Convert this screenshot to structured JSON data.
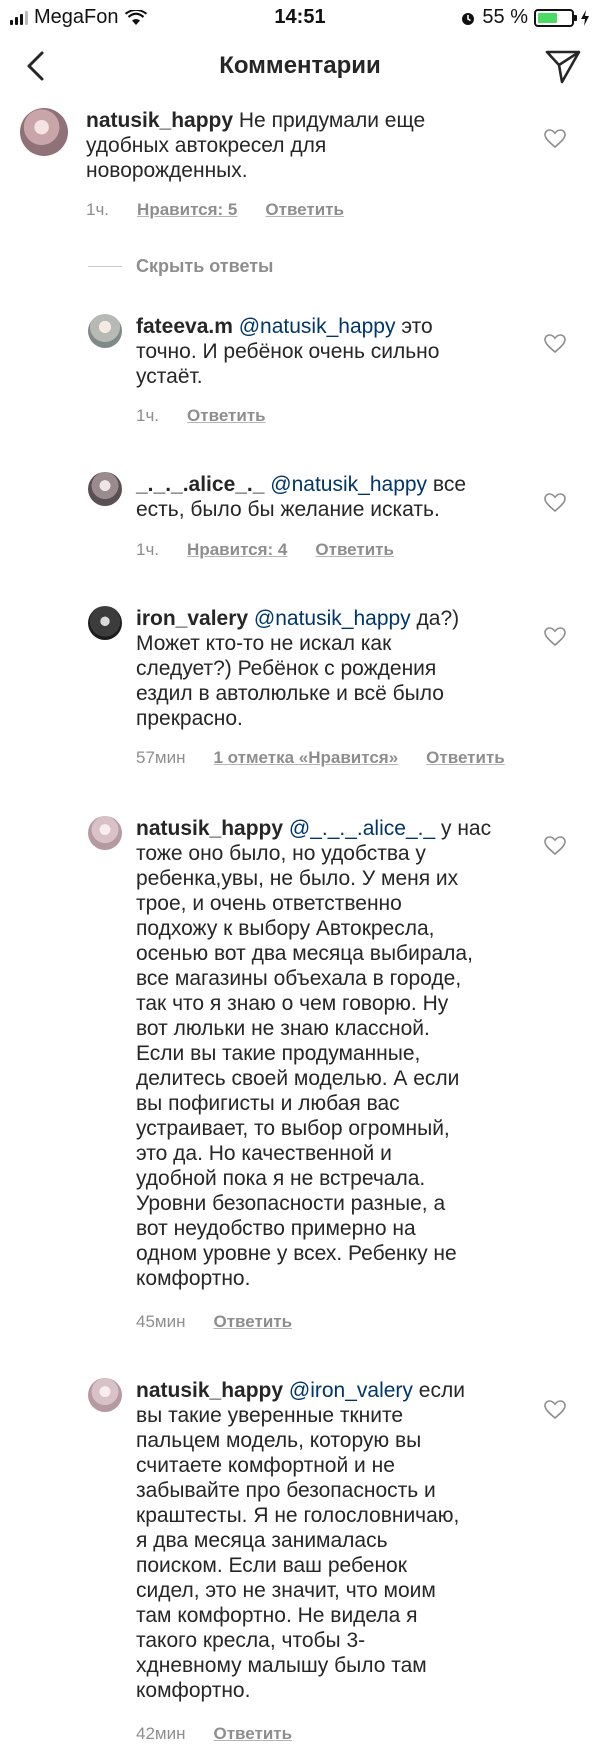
{
  "status_bar": {
    "carrier": "MegaFon",
    "time": "14:51",
    "battery_percent": "55 %",
    "battery_level": 0.55
  },
  "header": {
    "title": "Комментарии"
  },
  "comments": [
    {
      "username": "natusik_happy",
      "mention": "",
      "text_lines": [
        "Не придумали еще",
        "удобных автокресел для",
        "новорожденных."
      ],
      "time": "1ч.",
      "likes": "Нравится: 5",
      "reply": "Ответить"
    },
    {
      "username": "fateeva.m",
      "mention": "@natusik_happy",
      "text_lines": [
        "это",
        "точно. И ребёнок очень сильно",
        "устаёт."
      ],
      "time": "1ч.",
      "likes": "",
      "reply": "Ответить"
    },
    {
      "username": "_._._.alice_._",
      "mention": "@natusik_happy",
      "text_lines": [
        "все",
        "есть, было бы желание искать."
      ],
      "time": "1ч.",
      "likes": "Нравится: 4",
      "reply": "Ответить"
    },
    {
      "username": "iron_valery",
      "mention": "@natusik_happy",
      "text_lines": [
        "да?)",
        "Может кто-то не искал как",
        "следует?) Ребёнок с рождения",
        "ездил в автолюльке и всё было",
        "прекрасно."
      ],
      "time": "57мин",
      "likes": "1 отметка «Нравится»",
      "reply": "Ответить"
    },
    {
      "username": "natusik_happy",
      "mention": "@_._._.alice_._",
      "text_lines": [
        "у нас",
        "тоже оно было, но удобства у",
        "ребенка,увы, не было. У меня их",
        "трое, и очень ответственно",
        "подхожу к выбору Автокресла,",
        "осенью вот два месяца выбирала,",
        "все магазины объехала в городе,",
        "так что я знаю о чем говорю. Ну",
        "вот люльки не знаю классной.",
        "Если вы такие продуманные,",
        "делитесь своей моделью. А если",
        "вы пофигисты и любая вас",
        "устраивает, то выбор огромный,",
        "это да. Но качественной и",
        "удобной пока я не встречала.",
        "Уровни безопасности разные, а",
        "вот неудобство примерно на",
        "одном уровне у всех. Ребенку не",
        "комфортно."
      ],
      "time": "45мин",
      "likes": "",
      "reply": "Ответить"
    },
    {
      "username": "natusik_happy",
      "mention": "@iron_valery",
      "text_lines": [
        "если",
        "вы такие уверенные ткните",
        "пальцем модель, которую вы",
        "считаете комфортной и не",
        "забывайте про безопасность и",
        "краштесты. Я не голословничаю,",
        "я два месяца занималась",
        "поиском. Если ваш ребенок",
        "сидел, это не значит, что моим",
        "там комфортно. Не видела я",
        "такого кресла, чтобы 3-",
        "хдневному малышу было там",
        "комфортно."
      ],
      "time": "42мин",
      "likes": "",
      "reply": "Ответить"
    }
  ],
  "hide_replies": "Скрыть ответы"
}
